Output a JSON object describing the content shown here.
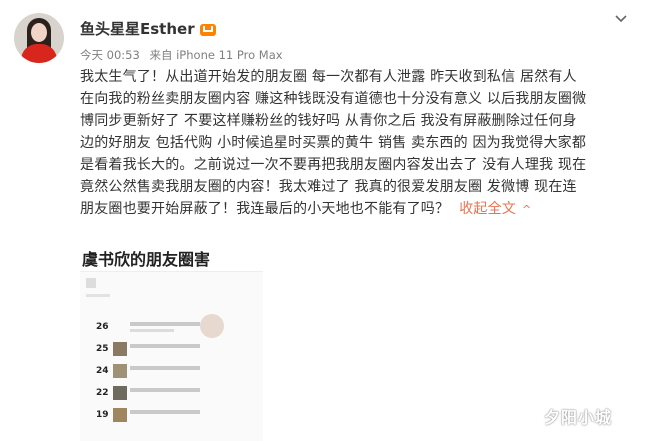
{
  "user": {
    "name": "鱼头星星Esther",
    "badge": "vip-icon"
  },
  "meta": {
    "time": "今天 00:53",
    "source": "来自 iPhone 11 Pro Max"
  },
  "post": {
    "lines": [
      "我太生气了！从出道开始发的朋友圈 每一次都有人泄露 昨天收到私信 居然有人",
      "在向我的粉丝卖朋友圈内容 赚这种钱既没有道德也十分没有意义 以后我朋友圈微",
      "博同步更新好了 不要这样赚粉丝的钱好吗 从青你之后 我没有屏蔽删除过任何身",
      "边的好朋友 包括代购 小时候追星时买票的黄牛 销售 卖东西的 因为我觉得大家都",
      "是看着我长大的。之前说过一次不要再把我朋友圈内容发出去了 没有人理我 现在",
      "竟然公然售卖我朋友圈的内容！我太难过了 我真的很爱发朋友圈 发微博 现在连",
      "朋友圈也要开始屏蔽了！我连最后的小天地也不能有了吗？"
    ],
    "collapse_label": "收起全文",
    "collapse_icon": "^"
  },
  "image": {
    "title": "虞书欣的朋友圈害",
    "dates": [
      "26",
      "25",
      "24",
      "22",
      "19"
    ]
  },
  "watermark": "夕阳小城"
}
